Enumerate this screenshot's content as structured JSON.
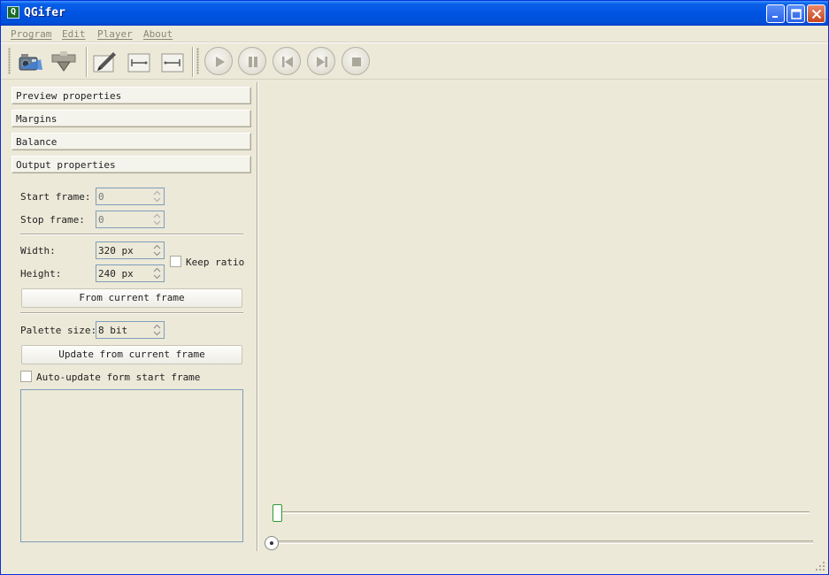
{
  "window": {
    "title": "QGifer",
    "app_icon_letter": "Q"
  },
  "menu": [
    "Program",
    "Edit",
    "Player",
    "About"
  ],
  "toolbar": {
    "file_tools": [
      "open-video-icon",
      "save-gif-icon"
    ],
    "edit_tools": [
      "edit-icon",
      "set-start-icon",
      "set-end-icon"
    ],
    "player_tools": [
      "play-icon",
      "pause-icon",
      "skip-back-icon",
      "skip-forward-icon",
      "stop-icon"
    ]
  },
  "sections": [
    "Preview properties",
    "Margins",
    "Balance",
    "Output properties"
  ],
  "output": {
    "start_frame_label": "Start frame:",
    "start_frame_value": "0",
    "stop_frame_label": "Stop frame:",
    "stop_frame_value": "0",
    "width_label": "Width:",
    "width_value": "320 px",
    "height_label": "Height:",
    "height_value": "240 px",
    "keep_ratio_label": "Keep ratio",
    "from_current_frame_label": "From current frame",
    "palette_size_label": "Palette size:",
    "palette_size_value": "8 bit",
    "update_from_current_label": "Update from current frame",
    "auto_update_label": "Auto-update form start frame"
  },
  "player": {
    "position_slider": 0,
    "seek_slider": 0
  }
}
